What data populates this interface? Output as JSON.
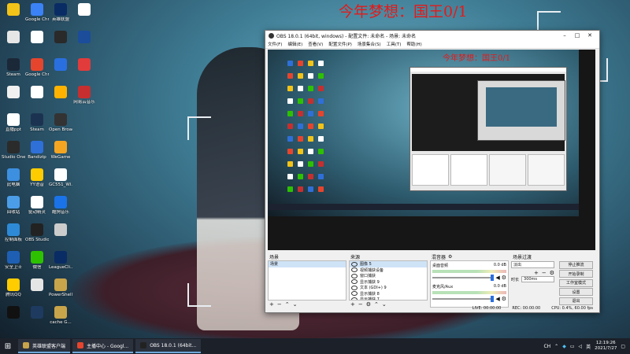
{
  "banner": "今年梦想：国王0/1",
  "desktop_icons": [
    {
      "label": "",
      "color": "#f2c318"
    },
    {
      "label": "Google Chrome",
      "color": "#3b82f6"
    },
    {
      "label": "英雄联盟",
      "color": "#0a2c64"
    },
    {
      "label": "",
      "color": "#e6e6e6"
    },
    {
      "label": "",
      "color": "#ffffff"
    },
    {
      "label": "",
      "color": "#2a2a2a"
    },
    {
      "label": "Steam",
      "color": "#1b2838"
    },
    {
      "label": "Google Chrome",
      "color": "#e6452d"
    },
    {
      "label": "",
      "color": "#2a6fe0"
    },
    {
      "label": "",
      "color": "#f0f0f0"
    },
    {
      "label": "",
      "color": "#ffffff"
    },
    {
      "label": "",
      "color": "#ffb300"
    },
    {
      "label": "",
      "color": "#ffffff"
    },
    {
      "label": "",
      "color": "#1b4d9b"
    },
    {
      "label": "",
      "color": "#e23b3b"
    },
    {
      "label": "直播ppt",
      "color": "#ffffff"
    },
    {
      "label": "Steam",
      "color": "#1b3350"
    },
    {
      "label": "Open Broadcast...",
      "color": "#333333"
    },
    {
      "label": "网易云音乐",
      "color": "#c62f2f"
    },
    {
      "label": "Studio One",
      "color": "#2b2b2b"
    },
    {
      "label": "Bandizip",
      "color": "#2f6fd8"
    },
    {
      "label": "WeGame",
      "color": "#f4a522"
    },
    {
      "label": "此电脑",
      "color": "#3d8fe0"
    },
    {
      "label": "YY语音",
      "color": "#ffcc00"
    },
    {
      "label": "GC551_Wi...",
      "color": "#ffffff"
    },
    {
      "label": "回收站",
      "color": "#4b9de8"
    },
    {
      "label": "驱动精灵",
      "color": "#ffffff"
    },
    {
      "label": "酷狗音乐",
      "color": "#1a73e8"
    },
    {
      "label": "控制面板",
      "color": "#2e8ad6"
    },
    {
      "label": "OBS Studio",
      "color": "#222222"
    },
    {
      "label": "",
      "color": "#cccccc"
    },
    {
      "label": "安全卫士",
      "color": "#1e5fb4"
    },
    {
      "label": "微信",
      "color": "#2dc100"
    },
    {
      "label": "LeagueCli...",
      "color": "#0a2c64"
    },
    {
      "label": "腾讯QQ",
      "color": "#ffcc00"
    },
    {
      "label": "",
      "color": "#e5e5e5"
    },
    {
      "label": "PowerShell...",
      "color": "#c8a44a"
    },
    {
      "label": "",
      "color": "#111111"
    },
    {
      "label": "",
      "color": "#1e3a5f"
    },
    {
      "label": "cache G...",
      "color": "#c8a44a"
    }
  ],
  "obs": {
    "title": "OBS 18.0.1 (64bit, windows) - 配置文件: 未命名 - 场景: 未命名",
    "menus": [
      "文件(F)",
      "编辑(E)",
      "查看(V)",
      "配置文件(P)",
      "场景集合(S)",
      "工具(T)",
      "帮助(H)"
    ],
    "preview_banner": "今年梦想：国王0/1",
    "scenes": {
      "header": "场景",
      "items": [
        "场景"
      ]
    },
    "sources": {
      "header": "来源",
      "items": [
        "图像 5",
        "视频捕获设备",
        "窗口捕获",
        "显示捕获 9",
        "文本 (GDI+) 9",
        "显示捕获 8",
        "显示捕获 7",
        "显示捕获 6",
        "显示捕获 5"
      ]
    },
    "mixer": {
      "header": "混音器",
      "channels": [
        {
          "name": "桌面音频",
          "level": "0.0 dB"
        },
        {
          "name": "麦克风/Aux",
          "level": "0.0 dB"
        }
      ]
    },
    "transitions": {
      "header": "场景过渡",
      "type": "淡出",
      "duration_label": "时长",
      "duration": "300ms"
    },
    "controls": [
      "停止推流",
      "开始录制",
      "工作室模式",
      "设置",
      "退出"
    ],
    "status": {
      "live": "LIVE: 00:00:00",
      "rec": "REC: 00:00:00",
      "cpu": "CPU: 0.4%, 60.00 fps"
    }
  },
  "taskbar": {
    "items": [
      {
        "label": "英雄联盟客户端",
        "color": "#c8a44a"
      },
      {
        "label": "主播中心 - Googl...",
        "color": "#e6452d"
      },
      {
        "label": "OBS 18.0.1 (64bit...",
        "color": "#222222"
      }
    ],
    "tray": [
      "CH",
      "英"
    ],
    "time": "12:19:26",
    "date": "2021/7/27"
  }
}
